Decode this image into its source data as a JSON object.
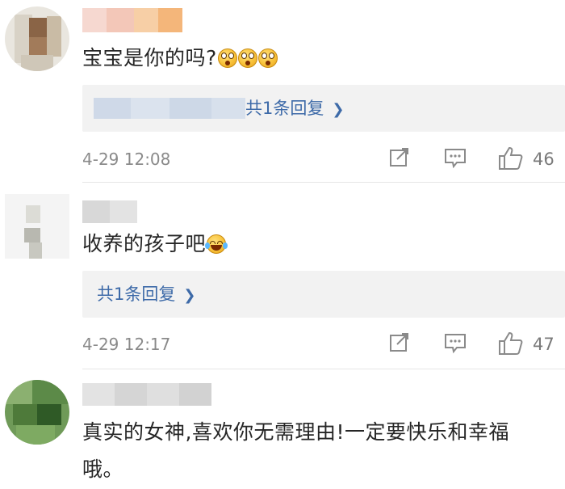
{
  "comments": [
    {
      "text": "宝宝是你的吗?",
      "reply_count_label": "共1条回复",
      "time": "4-29 12:08",
      "likes": "46"
    },
    {
      "text": "收养的孩子吧",
      "reply_count_label": "共1条回复",
      "time": "4-29 12:17",
      "likes": "47"
    },
    {
      "text": "真实的女神,喜欢你无需理由!一定要快乐和幸福哦。"
    }
  ],
  "icons": {
    "repost": "share-edit-icon",
    "comment": "comment-icon",
    "like": "thumbs-up-icon",
    "reply_chevron": "chevron-right-icon",
    "emoji_surprised": "surprised-face-emoji",
    "emoji_laughing": "laughing-tears-emoji"
  },
  "colors": {
    "link": "#3d6aa8",
    "meta": "#8a8a8a",
    "reply_bg": "#f2f2f2"
  }
}
